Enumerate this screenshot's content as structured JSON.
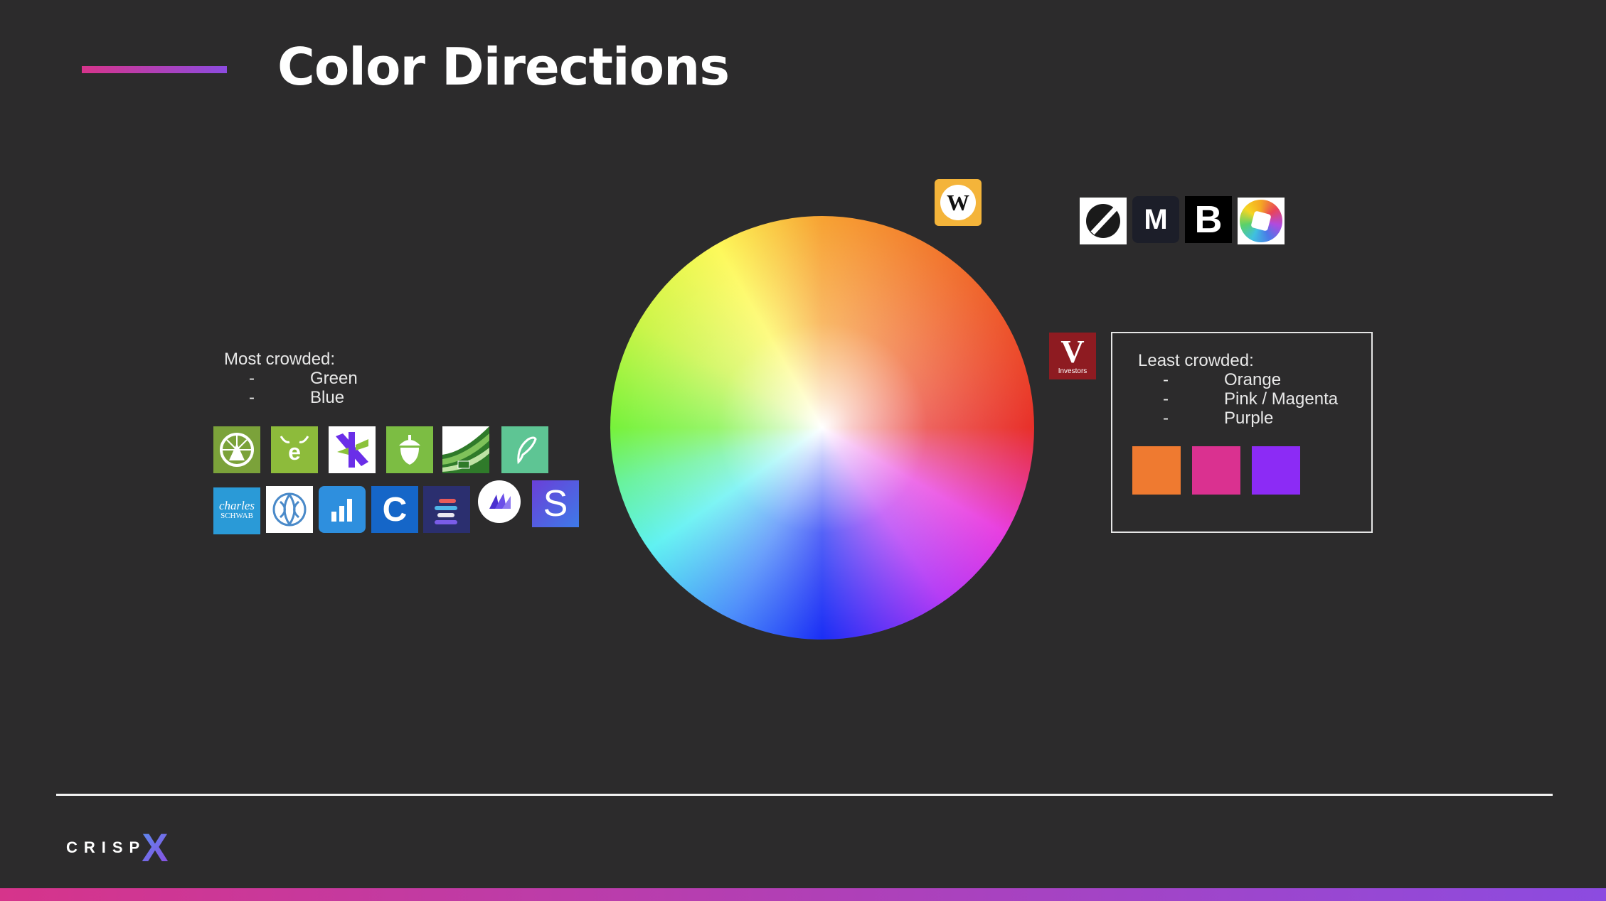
{
  "slide": {
    "title": "Color Directions"
  },
  "most_crowded": {
    "heading": "Most crowded:",
    "items": [
      "Green",
      "Blue"
    ],
    "bullet": "-"
  },
  "least_crowded": {
    "heading": "Least crowded:",
    "items": [
      "Orange",
      "Pink / Magenta",
      "Purple"
    ],
    "bullet": "-",
    "swatches": [
      "#ef7a30",
      "#da3190",
      "#8c2bf5"
    ]
  },
  "logos": {
    "green_row": [
      "fidelity-icon",
      "etrade-icon",
      "stash-x-icon",
      "acorns-icon",
      "td-ameritrade-icon",
      "robinhood-icon"
    ],
    "blue_row": [
      {
        "name": "charles-schwab-icon",
        "text_line1": "charles",
        "text_line2": "SCHWAB"
      },
      {
        "name": "vanguard-ish-icon"
      },
      {
        "name": "chart-bars-icon"
      },
      {
        "name": "c-icon",
        "text": "C"
      },
      {
        "name": "stacked-bars-icon"
      },
      {
        "name": "wealthfront-icon"
      },
      {
        "name": "stash-s-icon",
        "text": "S"
      }
    ],
    "top_right": [
      {
        "name": "slash-icon"
      },
      {
        "name": "m1-icon",
        "text": "M"
      },
      {
        "name": "b-icon",
        "text": "B"
      },
      {
        "name": "color-ring-icon"
      }
    ],
    "wealthsimple": {
      "text": "W"
    },
    "v_investors": {
      "letter": "V",
      "caption": "Investors"
    }
  },
  "footer": {
    "brand": "CRISP",
    "brand_mark": "X"
  }
}
